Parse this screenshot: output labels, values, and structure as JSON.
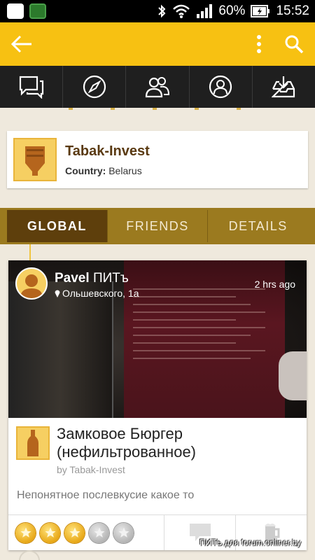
{
  "status_bar": {
    "battery": "60%",
    "time": "15:52",
    "icons": [
      "app-icon",
      "solitaire-icon",
      "bluetooth-icon",
      "wifi-icon",
      "signal-icon",
      "battery-icon"
    ]
  },
  "app_bar": {
    "background": "#f7c112",
    "icons": [
      "back-arrow-icon",
      "overflow-menu-icon",
      "search-icon"
    ]
  },
  "nav_tabs": [
    "chat-icon",
    "compass-icon",
    "friends-icon",
    "profile-icon",
    "inbox-download-icon"
  ],
  "brewery": {
    "name": "Tabak-Invest",
    "country_label": "Country:",
    "country": "Belarus"
  },
  "feed_tabs": {
    "items": [
      "GLOBAL",
      "FRIENDS",
      "DETAILS"
    ],
    "active": "GLOBAL"
  },
  "checkin": {
    "user_first": "Pavel",
    "user_last": "ПИТъ",
    "location": "Ольшевского, 1а",
    "time_ago": "2 hrs ago",
    "beer_name": "Замковое Бюргер (нефильтрованное)",
    "beer_brewery": "by Tabak-Invest",
    "comment": "Непонятное послевкусие какое то",
    "rating": 3,
    "rating_max": 5
  },
  "watermark": "ПИТЬ для forum.onliner.by"
}
